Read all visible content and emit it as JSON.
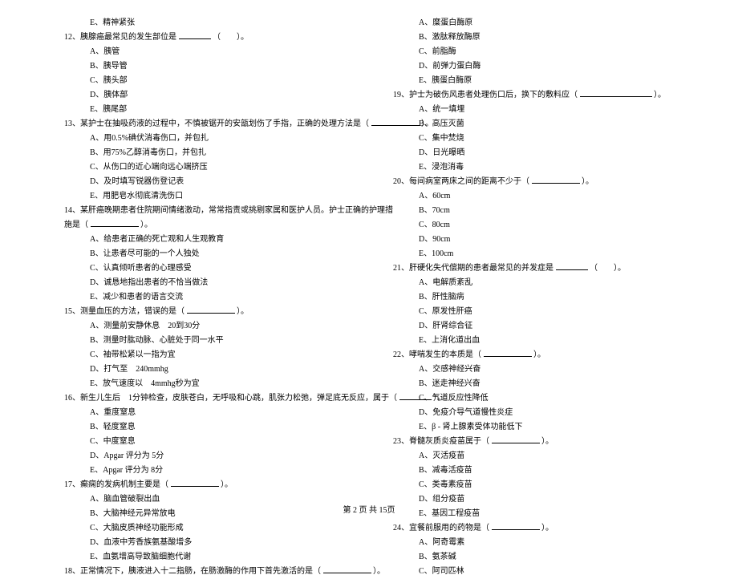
{
  "left_col": {
    "q11_opt_e": "E、精神紧张",
    "q12_stem": "12、胰腺癌最常见的发生部位是",
    "q12_paren": "（　　）。",
    "q12_a": "A、胰管",
    "q12_b": "B、胰导管",
    "q12_c": "C、胰头部",
    "q12_d": "D、胰体部",
    "q12_e": "E、胰尾部",
    "q13_stem": "13、某护士在抽吸药液的过程中，不慎被锯开的安瓿划伤了手指，正确的处理方法是（",
    "q13_paren": "）。",
    "q13_a": "A、用0.5%碘伏消毒伤口，并包扎",
    "q13_b": "B、用75%乙醇消毒伤口，并包扎",
    "q13_c": "C、从伤口的近心端向远心端挤压",
    "q13_d": "D、及时填写锐器伤登记表",
    "q13_e": "E、用肥皂水彻底清洗伤口",
    "q14_stem": "14、某肝癌晚期患者住院期间情绪激动，常常指责或挑剔家属和医护人员。护士正确的护理措",
    "q14_line2": "施是（",
    "q14_paren": "）。",
    "q14_a": "A、给患者正确的死亡观和人生观教育",
    "q14_b": "B、让患者尽可能的一个人独处",
    "q14_c": "C、认真倾听患者的心理感受",
    "q14_d": "D、诚恳地指出患者的不恰当做法",
    "q14_e": "E、减少和患者的语言交流",
    "q15_stem": "15、测量血压的方法，错误的是（",
    "q15_paren": "）。",
    "q15_a": "A、测量前安静休息　20到30分",
    "q15_b": "B、测量时肱动脉、心脏处于同一水平",
    "q15_c": "C、袖带松紧以一指为宜",
    "q15_d": "D、打气至　240mmhg",
    "q15_e": "E、放气速度以　4mmhg秒为宜",
    "q16_stem": "16、新生儿生后　1分钟检查，皮肤苍白，无呼吸和心跳，肌张力松弛，弹足底无反应，属于（",
    "q16_paren": "）。",
    "q16_a": "A、重度窒息",
    "q16_b": "B、轻度窒息",
    "q16_c": "C、中度窒息",
    "q16_d": "D、Apgar 评分为 5分",
    "q16_e": "E、Apgar 评分为 8分",
    "q17_stem": "17、癫痫的发病机制主要是（",
    "q17_paren": "）。",
    "q17_a": "A、脑血管破裂出血",
    "q17_b": "B、大脑神经元异常放电",
    "q17_c": "C、大脑皮质神经功能形成",
    "q17_d": "D、血液中芳香族氨基酸增多",
    "q17_e": "E、血氨增高导致脑细胞代谢",
    "q18_stem": "18、正常情况下，胰液进入十二指肠，在肠激酶的作用下首先激活的是（",
    "q18_paren": "）。"
  },
  "right_col": {
    "q18_a": "A、糜蛋白酶原",
    "q18_b": "B、激肽释放酶原",
    "q18_c": "C、前脂酶",
    "q18_d": "D、前弹力蛋白酶",
    "q18_e": "E、胰蛋白酶原",
    "q19_stem": "19、护士为破伤风患者处理伤口后，换下的敷料应（",
    "q19_paren": "）。",
    "q19_a": "A、统一填埋",
    "q19_b": "B、高压灭菌",
    "q19_c": "C、集中焚烧",
    "q19_d": "D、日光曝晒",
    "q19_e": "E、浸泡消毒",
    "q20_stem": "20、每间病室两床之间的距离不少于（",
    "q20_paren": "）。",
    "q20_a": "A、60cm",
    "q20_b": "B、70cm",
    "q20_c": "C、80cm",
    "q20_d": "D、90cm",
    "q20_e": "E、100cm",
    "q21_stem": "21、肝硬化失代偿期的患者最常见的并发症是",
    "q21_paren": "（　　）。",
    "q21_a": "A、电解质紊乱",
    "q21_b": "B、肝性脑病",
    "q21_c": "C、原发性肝癌",
    "q21_d": "D、肝肾综合征",
    "q21_e": "E、上消化道出血",
    "q22_stem": "22、哮喘发生的本质是（",
    "q22_paren": "）。",
    "q22_a": "A、交感神经兴奋",
    "q22_b": "B、迷走神经兴奋",
    "q22_c": "C、气道反应性降低",
    "q22_d": "D、免疫介导气道慢性炎症",
    "q22_e": "E、β - 肾上腺素受体功能低下",
    "q23_stem": "23、脊髓灰质炎疫苗属于（",
    "q23_paren": "）。",
    "q23_a": "A、灭活疫苗",
    "q23_b": "B、减毒活疫苗",
    "q23_c": "C、类毒素疫苗",
    "q23_d": "D、组分疫苗",
    "q23_e": "E、基因工程疫苗",
    "q24_stem": "24、宜餐前服用的药物是（",
    "q24_paren": "）。",
    "q24_a": "A、阿奇霉素",
    "q24_b": "B、氨茶碱",
    "q24_c": "C、阿司匹林"
  },
  "footer": "第 2 页 共 15页"
}
